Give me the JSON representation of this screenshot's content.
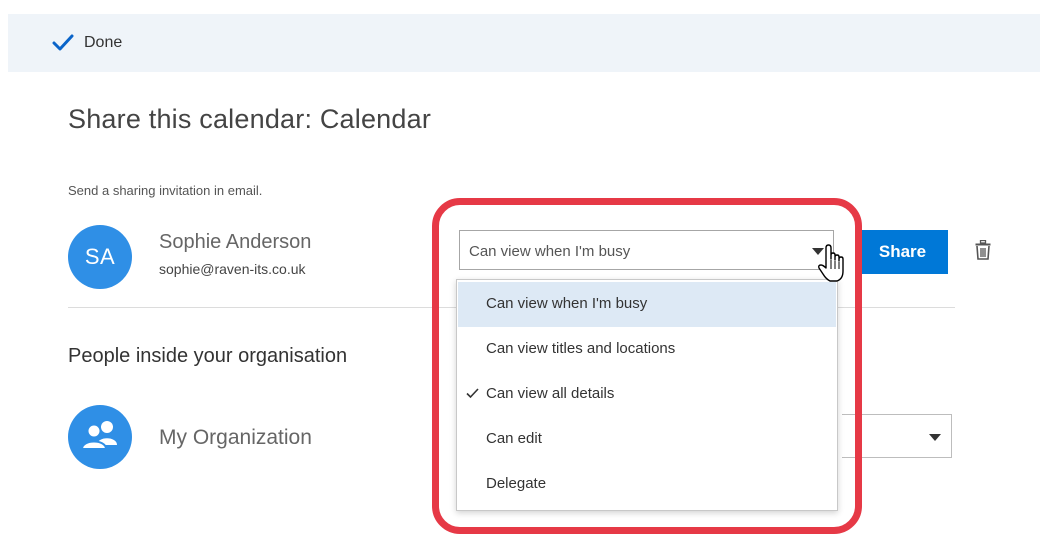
{
  "toolbar": {
    "done_label": "Done",
    "done_icon": "checkmark-icon"
  },
  "page": {
    "title": "Share this calendar: Calendar",
    "invite_hint": "Send a sharing invitation in email."
  },
  "invitee": {
    "initials": "SA",
    "name": "Sophie Anderson",
    "email": "sophie@raven-its.co.uk",
    "permission_selected": "Can view when I'm busy"
  },
  "actions": {
    "share_label": "Share",
    "delete_icon": "trash-icon"
  },
  "organisation": {
    "heading": "People inside your organisation",
    "name": "My Organization",
    "avatar_icon": "people-group-icon"
  },
  "dropdown": {
    "items": [
      {
        "label": "Can view when I'm busy",
        "hovered": true,
        "checked": false
      },
      {
        "label": "Can view titles and locations",
        "hovered": false,
        "checked": false
      },
      {
        "label": "Can view all details",
        "hovered": false,
        "checked": true
      },
      {
        "label": "Can edit",
        "hovered": false,
        "checked": false
      },
      {
        "label": "Delegate",
        "hovered": false,
        "checked": false
      }
    ]
  },
  "colors": {
    "accent": "#0078d7",
    "avatar": "#2f8fe6",
    "highlight_ring": "#e63946",
    "hover_row": "#dde9f5",
    "top_bar": "#eff4f9"
  }
}
